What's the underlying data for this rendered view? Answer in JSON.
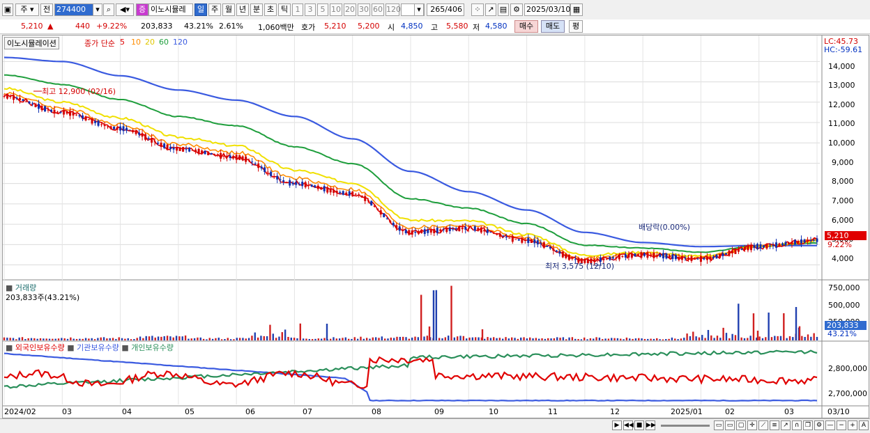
{
  "toolbar": {
    "period_kind": "주",
    "prev_label": "전",
    "code": "274400",
    "name_badge": "증",
    "name": "이노시뮬레",
    "periods": [
      "일",
      "주",
      "월",
      "년",
      "분",
      "초",
      "틱"
    ],
    "active_period": "일",
    "nums": [
      "1",
      "3",
      "5",
      "10",
      "20",
      "30",
      "60",
      "120"
    ],
    "count": "265",
    "total": "/406",
    "date": "2025/03/10"
  },
  "info": {
    "price": "5,210",
    "arrow": "▲",
    "change": "440",
    "rate": "+9.22%",
    "volume": "203,833",
    "vol_rate": "43.21%",
    "turnover": "2.61%",
    "amount": "1,060백만",
    "hoga_label": "호가",
    "ask": "5,210",
    "bid": "5,200",
    "open_label": "시",
    "open": "4,850",
    "high_label": "고",
    "high": "5,580",
    "low_label": "저",
    "low": "4,580",
    "buy": "매수",
    "sell": "매도",
    "eval": "평"
  },
  "price_panel": {
    "name": "이노시뮬레이션",
    "ma_title": "종가 단순",
    "ma_periods": [
      "5",
      "10",
      "20",
      "60",
      "120"
    ],
    "ma_colors": [
      "#e00000",
      "#ff8c00",
      "#f0e000",
      "#1e9e3c",
      "#3a5ae0"
    ],
    "lc": "LC:45.73",
    "hc": "HC:-59.61",
    "y_ticks": [
      "14,000",
      "13,000",
      "12,000",
      "11,000",
      "10,000",
      "9,000",
      "8,000",
      "7,000",
      "6,000",
      "5,000",
      "4,000"
    ],
    "high_note": "최고 12,900 (02/16)",
    "low_note": "최저 3,575 (12/10)",
    "div_note": "배당락(0.00%)",
    "last_price": "5,210",
    "last_rate": "9.22%"
  },
  "volume_panel": {
    "title": "거래량",
    "value": "203,833주(43.21%)",
    "y_ticks": [
      "750,000",
      "500,000",
      "250,000"
    ],
    "last_value": "203,833",
    "last_rate": "43.21%"
  },
  "holding_panel": {
    "series": [
      "외국인보유수량",
      "기관보유수량",
      "개인보유수량"
    ],
    "colors": [
      "#e00000",
      "#3a5ae0",
      "#2a8f5a"
    ],
    "y_ticks": [
      "2,800,000",
      "2,700,000"
    ]
  },
  "x_axis": [
    "2024/02",
    "03",
    "04",
    "05",
    "06",
    "07",
    "08",
    "09",
    "10",
    "11",
    "12",
    "2025/01",
    "02",
    "03",
    "03/10"
  ],
  "chart_data": {
    "type": "line",
    "x": [
      "2024/02",
      "2024/03",
      "2024/04",
      "2024/05",
      "2024/06",
      "2024/07",
      "2024/08",
      "2024/09",
      "2024/10",
      "2024/11",
      "2024/12",
      "2025/01",
      "2025/02",
      "2025/03",
      "2025/03/10"
    ],
    "series": [
      {
        "name": "5",
        "values": [
          12300,
          11500,
          10700,
          9700,
          9300,
          8000,
          7500,
          5600,
          5800,
          5200,
          4200,
          4500,
          4300,
          4900,
          5210
        ]
      },
      {
        "name": "120",
        "values": [
          14200,
          14000,
          13300,
          12600,
          12100,
          11300,
          10200,
          8600,
          7600,
          6700,
          5600,
          5100,
          4900,
          4950,
          4950
        ]
      }
    ],
    "ylim": [
      3300,
      14800
    ],
    "volume": [
      40000,
      45000,
      40000,
      60000,
      35000,
      240000,
      40000,
      50000,
      720000,
      45000,
      40000,
      40000,
      35000,
      160000,
      480000,
      203833
    ],
    "holding": {
      "외국인보유수량": 2840000,
      "기관보유수량": 2650000,
      "개인보유수량": 2860000
    }
  }
}
